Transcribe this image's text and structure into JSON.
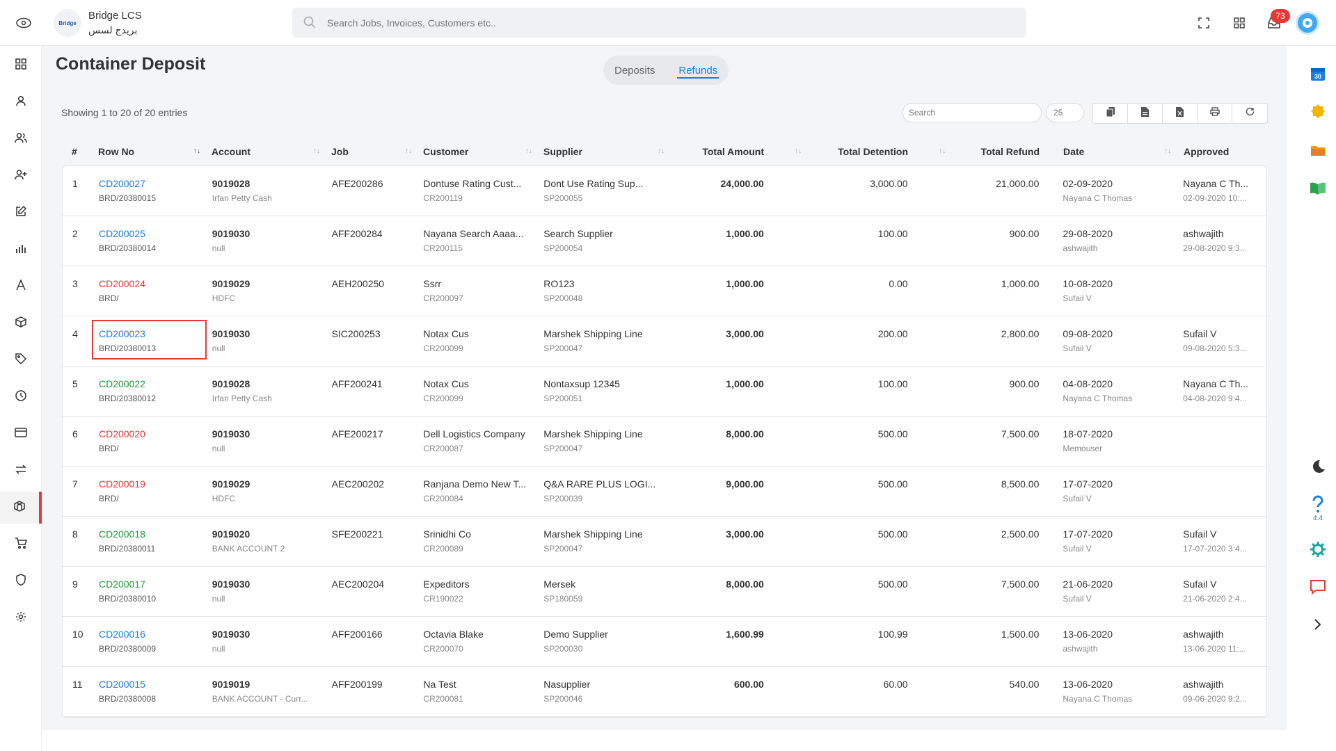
{
  "brand": {
    "logo_text": "Bridge",
    "name": "Bridge LCS",
    "name_arabic": "بريدج لسس"
  },
  "search": {
    "placeholder": "Search Jobs, Invoices, Customers etc.."
  },
  "notifications": {
    "count": "73"
  },
  "page": {
    "title": "Container Deposit"
  },
  "tabs": [
    {
      "label": "Deposits",
      "active": false
    },
    {
      "label": "Refunds",
      "active": true
    }
  ],
  "table_meta": {
    "showing": "Showing 1 to 20 of 20 entries",
    "search_placeholder": "Search",
    "page_size": "25"
  },
  "columns": [
    "#",
    "Row No",
    "Account",
    "Job",
    "Customer",
    "Supplier",
    "Total Amount",
    "Total Detention",
    "Total Refund",
    "Date",
    "Approved"
  ],
  "rows": [
    {
      "idx": "1",
      "row_no": "CD200027",
      "row_no_color": "blue",
      "row_sub": "BRD/20380015",
      "account": "9019028",
      "account_sub": "Irfan Petty Cash",
      "job": "AFE200286",
      "customer": "Dontuse Rating Cust...",
      "customer_sub": "CR200119",
      "supplier": "Dont Use Rating Sup...",
      "supplier_sub": "SP200055",
      "total": "24,000.00",
      "detention": "3,000.00",
      "refund": "21,000.00",
      "date": "02-09-2020",
      "date_sub": "Nayana C Thomas",
      "approved": "Nayana C Th...",
      "approved_sub": "02-09-2020 10:..."
    },
    {
      "idx": "2",
      "row_no": "CD200025",
      "row_no_color": "blue",
      "row_sub": "BRD/20380014",
      "account": "9019030",
      "account_sub": "null",
      "job": "AFF200284",
      "customer": "Nayana Search Aaaa...",
      "customer_sub": "CR200115",
      "supplier": "Search Supplier",
      "supplier_sub": "SP200054",
      "total": "1,000.00",
      "detention": "100.00",
      "refund": "900.00",
      "date": "29-08-2020",
      "date_sub": "ashwajith",
      "approved": "ashwajith",
      "approved_sub": "29-08-2020 9:3..."
    },
    {
      "idx": "3",
      "row_no": "CD200024",
      "row_no_color": "red",
      "row_sub": "BRD/",
      "account": "9019029",
      "account_sub": "HDFC",
      "job": "AEH200250",
      "customer": "Ssrr",
      "customer_sub": "CR200097",
      "supplier": "RO123",
      "supplier_sub": "SP200048",
      "total": "1,000.00",
      "detention": "0.00",
      "refund": "1,000.00",
      "date": "10-08-2020",
      "date_sub": "Sufail V",
      "approved": "",
      "approved_sub": ""
    },
    {
      "idx": "4",
      "row_no": "CD200023",
      "row_no_color": "blue",
      "row_sub": "BRD/20380013",
      "account": "9019030",
      "account_sub": "null",
      "job": "SIC200253",
      "customer": "Notax Cus",
      "customer_sub": "CR200099",
      "supplier": "Marshek Shipping Line",
      "supplier_sub": "SP200047",
      "total": "3,000.00",
      "detention": "200.00",
      "refund": "2,800.00",
      "date": "09-08-2020",
      "date_sub": "Sufail V",
      "approved": "Sufail V",
      "approved_sub": "09-08-2020 5:3...",
      "highlighted": true
    },
    {
      "idx": "5",
      "row_no": "CD200022",
      "row_no_color": "green",
      "row_sub": "BRD/20380012",
      "account": "9019028",
      "account_sub": "Irfan Petty Cash",
      "job": "AFF200241",
      "customer": "Notax Cus",
      "customer_sub": "CR200099",
      "supplier": "Nontaxsup 12345",
      "supplier_sub": "SP200051",
      "total": "1,000.00",
      "detention": "100.00",
      "refund": "900.00",
      "date": "04-08-2020",
      "date_sub": "Nayana C Thomas",
      "approved": "Nayana C Th...",
      "approved_sub": "04-08-2020 9:4..."
    },
    {
      "idx": "6",
      "row_no": "CD200020",
      "row_no_color": "red",
      "row_sub": "BRD/",
      "account": "9019030",
      "account_sub": "null",
      "job": "AFE200217",
      "customer": "Dell Logistics Company",
      "customer_sub": "CR200087",
      "supplier": "Marshek Shipping Line",
      "supplier_sub": "SP200047",
      "total": "8,000.00",
      "detention": "500.00",
      "refund": "7,500.00",
      "date": "18-07-2020",
      "date_sub": "Memouser",
      "approved": "",
      "approved_sub": ""
    },
    {
      "idx": "7",
      "row_no": "CD200019",
      "row_no_color": "red",
      "row_sub": "BRD/",
      "account": "9019029",
      "account_sub": "HDFC",
      "job": "AEC200202",
      "customer": "Ranjana Demo New T...",
      "customer_sub": "CR200084",
      "supplier": "Q&A RARE PLUS LOGI...",
      "supplier_sub": "SP200039",
      "total": "9,000.00",
      "detention": "500.00",
      "refund": "8,500.00",
      "date": "17-07-2020",
      "date_sub": "Sufail V",
      "approved": "",
      "approved_sub": ""
    },
    {
      "idx": "8",
      "row_no": "CD200018",
      "row_no_color": "green",
      "row_sub": "BRD/20380011",
      "account": "9019020",
      "account_sub": "BANK ACCOUNT 2",
      "job": "SFE200221",
      "customer": "Srinidhi Co",
      "customer_sub": "CR200089",
      "supplier": "Marshek Shipping Line",
      "supplier_sub": "SP200047",
      "total": "3,000.00",
      "detention": "500.00",
      "refund": "2,500.00",
      "date": "17-07-2020",
      "date_sub": "Sufail V",
      "approved": "Sufail V",
      "approved_sub": "17-07-2020 3:4..."
    },
    {
      "idx": "9",
      "row_no": "CD200017",
      "row_no_color": "green",
      "row_sub": "BRD/20380010",
      "account": "9019030",
      "account_sub": "null",
      "job": "AEC200204",
      "customer": "Expeditors",
      "customer_sub": "CR190022",
      "supplier": "Mersek",
      "supplier_sub": "SP180059",
      "total": "8,000.00",
      "detention": "500.00",
      "refund": "7,500.00",
      "date": "21-06-2020",
      "date_sub": "Sufail V",
      "approved": "Sufail V",
      "approved_sub": "21-06-2020 2:4..."
    },
    {
      "idx": "10",
      "row_no": "CD200016",
      "row_no_color": "blue",
      "row_sub": "BRD/20380009",
      "account": "9019030",
      "account_sub": "null",
      "job": "AFF200166",
      "customer": "Octavia Blake",
      "customer_sub": "CR200070",
      "supplier": "Demo Supplier",
      "supplier_sub": "SP200030",
      "total": "1,600.99",
      "detention": "100.99",
      "refund": "1,500.00",
      "date": "13-06-2020",
      "date_sub": "ashwajith",
      "approved": "ashwajith",
      "approved_sub": "13-06-2020 11:..."
    },
    {
      "idx": "11",
      "row_no": "CD200015",
      "row_no_color": "blue",
      "row_sub": "BRD/20380008",
      "account": "9019019",
      "account_sub": "BANK ACCOUNT - Curr...",
      "job": "AFF200199",
      "customer": "Na Test",
      "customer_sub": "CR200081",
      "supplier": "Nasupplier",
      "supplier_sub": "SP200046",
      "total": "600.00",
      "detention": "60.00",
      "refund": "540.00",
      "date": "13-06-2020",
      "date_sub": "Nayana C Thomas",
      "approved": "ashwajith",
      "approved_sub": "09-06-2020 9:2..."
    }
  ],
  "rightrail": {
    "calendar_day": "30",
    "version": "4.4"
  },
  "colors": {
    "accent": "#1b7fe0",
    "danger": "#e53935",
    "success": "#1e9c3c"
  },
  "icons": {
    "sidebar": [
      "dashboard-icon",
      "user-icon",
      "users-icon",
      "add-user-icon",
      "edit-icon",
      "bar-chart-icon",
      "font-icon",
      "box-icon",
      "tag-icon",
      "clock-icon",
      "credit-card-icon",
      "exchange-icon",
      "containers-icon",
      "cart-icon",
      "shield-icon",
      "settings-icon"
    ],
    "toolbar": [
      "copy-icon",
      "csv-icon",
      "excel-icon",
      "print-icon",
      "refresh-icon"
    ]
  }
}
